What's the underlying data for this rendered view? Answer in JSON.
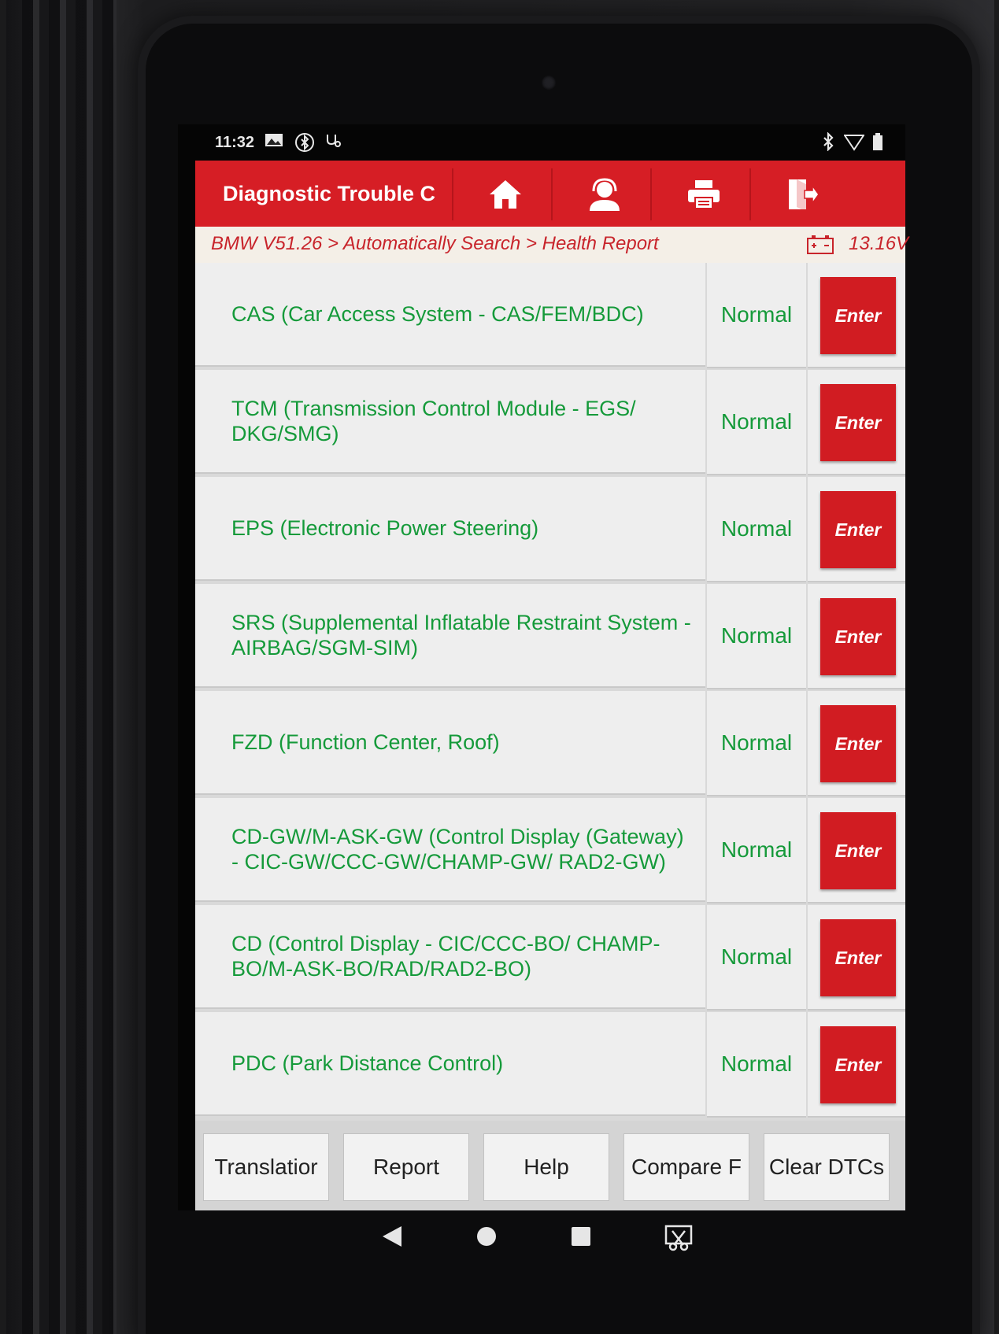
{
  "status_bar": {
    "time": "11:32",
    "icons_left": [
      "gallery-icon",
      "bluetooth-diagnostic-icon",
      "stethoscope-icon"
    ],
    "icons_right": [
      "bluetooth-icon",
      "wifi-icon",
      "battery-icon"
    ]
  },
  "header": {
    "title": "Diagnostic Trouble C",
    "buttons": [
      "home-icon",
      "support-agent-icon",
      "printer-icon",
      "exit-icon"
    ],
    "accent_color": "#d61e25"
  },
  "breadcrumb": {
    "path": "BMW V51.26 > Automatically Search > Health Report",
    "voltage": "13.16V"
  },
  "modules": [
    {
      "name": "CAS (Car Access System - CAS/FEM/BDC)",
      "status": "Normal",
      "action": "Enter"
    },
    {
      "name": "TCM (Transmission Control Module - EGS/ DKG/SMG)",
      "status": "Normal",
      "action": "Enter"
    },
    {
      "name": "EPS (Electronic Power Steering)",
      "status": "Normal",
      "action": "Enter"
    },
    {
      "name": "SRS (Supplemental Inflatable Restraint System - AIRBAG/SGM-SIM)",
      "status": "Normal",
      "action": "Enter"
    },
    {
      "name": "FZD (Function Center, Roof)",
      "status": "Normal",
      "action": "Enter"
    },
    {
      "name": "CD-GW/M-ASK-GW (Control Display (Gateway) - CIC-GW/CCC-GW/CHAMP-GW/ RAD2-GW)",
      "status": "Normal",
      "action": "Enter"
    },
    {
      "name": "CD (Control Display - CIC/CCC-BO/ CHAMP-BO/M-ASK-BO/RAD/RAD2-BO)",
      "status": "Normal",
      "action": "Enter"
    },
    {
      "name": "PDC (Park Distance Control)",
      "status": "Normal",
      "action": "Enter"
    }
  ],
  "footer": {
    "translation": "Translatior",
    "report": "Report",
    "help": "Help",
    "compare": "Compare F",
    "clear_dtcs": "Clear DTCs"
  },
  "navbar": [
    "back-icon",
    "home-circle-icon",
    "recents-icon",
    "screenshot-icon"
  ],
  "colors": {
    "status_text": "#159a3a",
    "enter_button": "#d11c22",
    "breadcrumb_text": "#c8242b"
  }
}
